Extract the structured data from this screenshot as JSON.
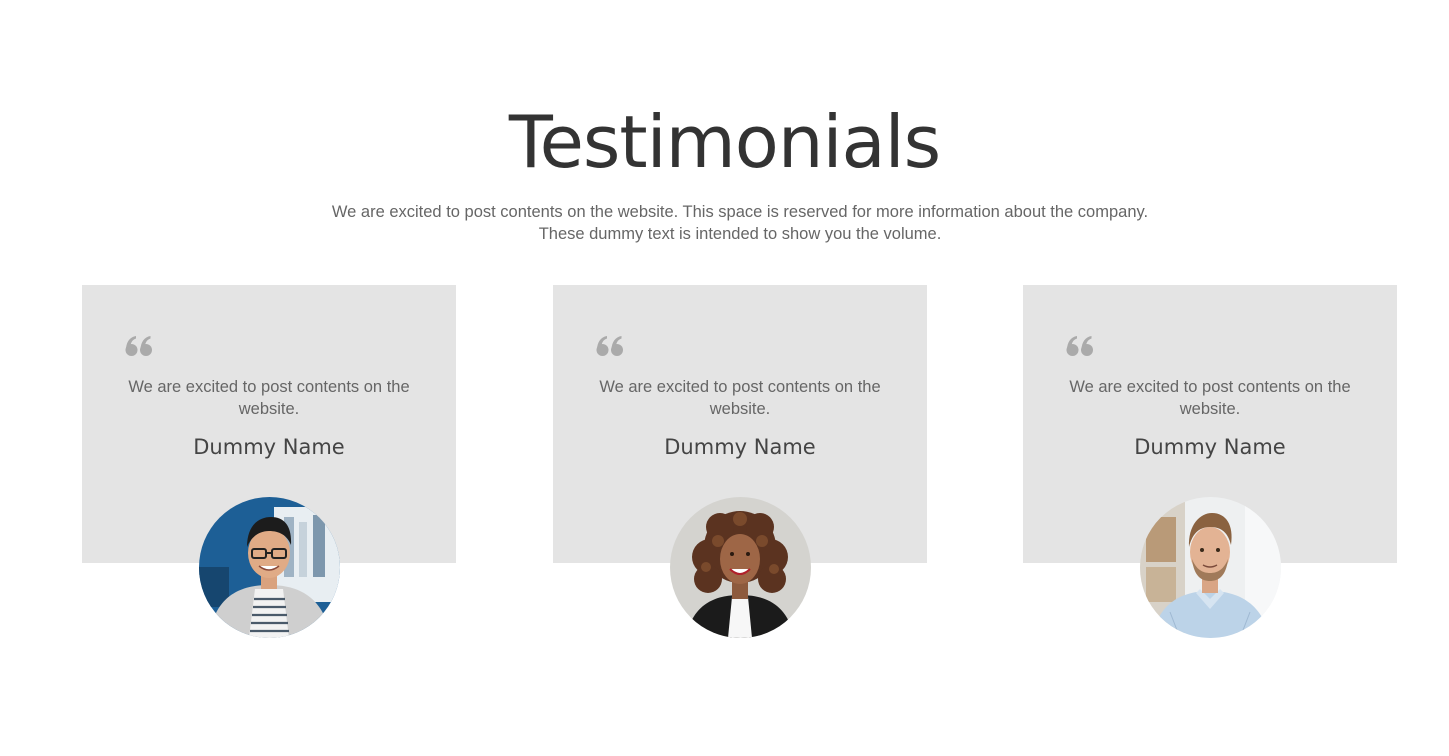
{
  "section": {
    "title": "Testimonials",
    "subtitle": "We are excited to post contents on the website. This space is reserved for more information about the company. These dummy text is intended to show you the volume."
  },
  "testimonials": [
    {
      "quote": "We are excited to post contents on the website.",
      "name": "Dummy Name"
    },
    {
      "quote": "We are excited to post contents on the website.",
      "name": "Dummy Name"
    },
    {
      "quote": "We are excited to post contents on the website.",
      "name": "Dummy Name"
    }
  ],
  "icons": {
    "quote": "quote-icon"
  },
  "colors": {
    "card_background": "#e4e4e4",
    "quote_icon": "#aaaaaa",
    "title": "#333333",
    "text": "#666666"
  }
}
